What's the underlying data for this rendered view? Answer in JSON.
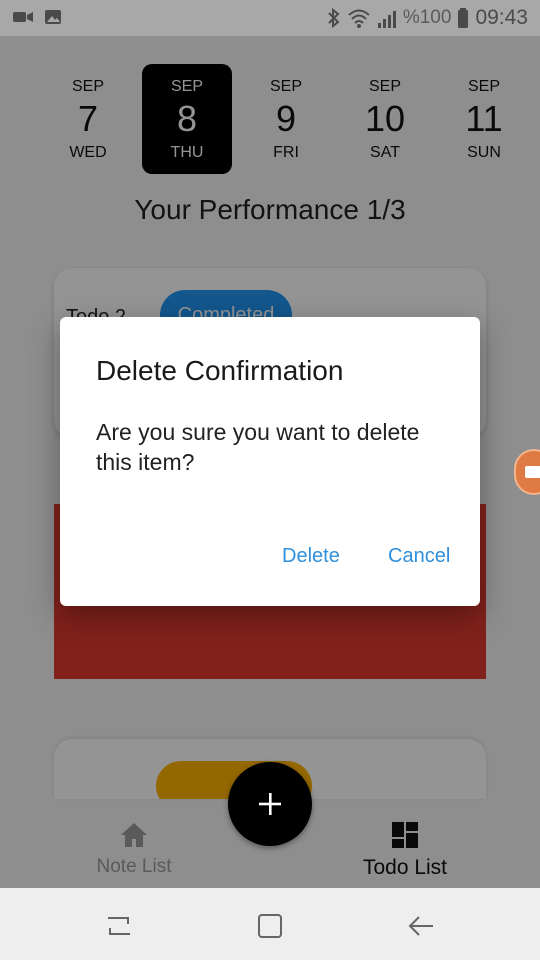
{
  "status_bar": {
    "battery_text": "%100",
    "time": "09:43",
    "icons_left": [
      "video-call-icon",
      "image-icon"
    ],
    "icons_right": [
      "bluetooth-icon",
      "wifi-icon",
      "signal-icon",
      "battery-icon"
    ]
  },
  "dates": [
    {
      "mon": "SEP",
      "day": "7",
      "dow": "WED",
      "selected": false
    },
    {
      "mon": "SEP",
      "day": "8",
      "dow": "THU",
      "selected": true
    },
    {
      "mon": "SEP",
      "day": "9",
      "dow": "FRI",
      "selected": false
    },
    {
      "mon": "SEP",
      "day": "10",
      "dow": "SAT",
      "selected": false
    },
    {
      "mon": "SEP",
      "day": "11",
      "dow": "SUN",
      "selected": false
    }
  ],
  "performance_text": "Your Performance 1/3",
  "todo_card": {
    "title": "Todo 2",
    "status": "Completed"
  },
  "dialog": {
    "title": "Delete Confirmation",
    "message": "Are you sure you want to delete this item?",
    "delete_label": "Delete",
    "cancel_label": "Cancel"
  },
  "bottom_nav": {
    "items": [
      {
        "label": "Note List",
        "icon": "home-icon",
        "active": false
      },
      {
        "label": "Todo List",
        "icon": "dashboard-icon",
        "active": true
      }
    ],
    "fab_icon": "plus-icon"
  },
  "colors": {
    "selected_date_bg": "#000000",
    "pill_blue": "#2196f3",
    "swipe_delete_red": "#e03a2f",
    "pill_amber": "#ffb300",
    "dialog_button": "#2f8fdb"
  }
}
